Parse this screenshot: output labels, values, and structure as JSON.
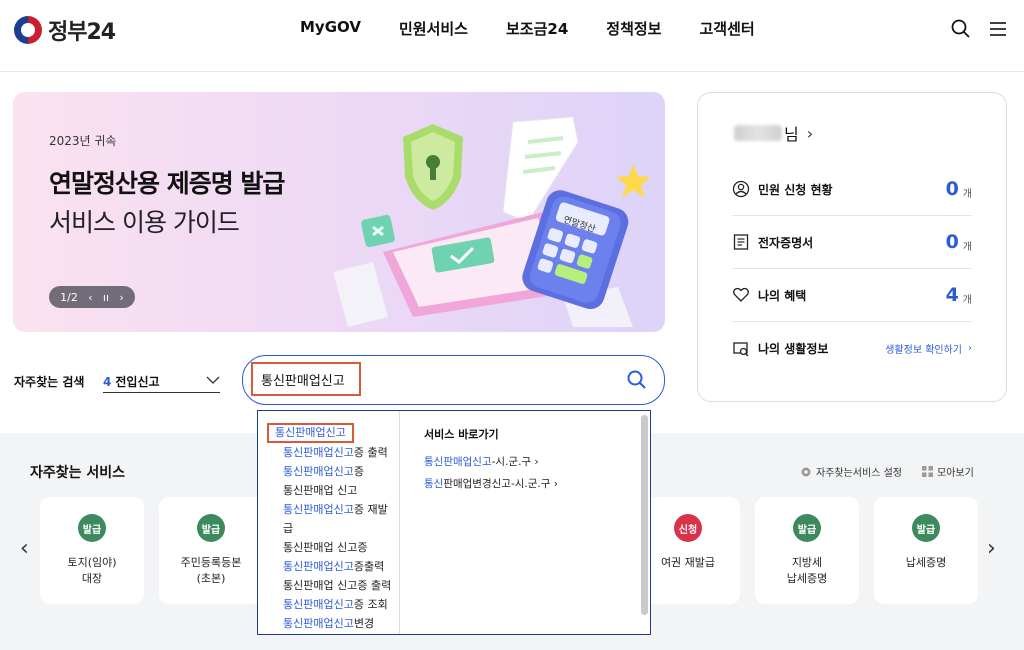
{
  "header": {
    "logo_text": "정부24",
    "nav": [
      "MyGOV",
      "민원서비스",
      "보조금24",
      "정책정보",
      "고객센터"
    ],
    "icons": [
      "search-icon",
      "menu-icon"
    ]
  },
  "banner": {
    "year": "2023년 귀속",
    "title": "연말정산용 제증명 발급",
    "subtitle": "서비스 이용 가이드",
    "pager": "1/2",
    "calculator_label": "연말정산"
  },
  "search": {
    "frequent_label": "자주찾는 검색",
    "frequent_rank": "4",
    "frequent_term": "전입신고",
    "query": "통신판매업신고"
  },
  "panel": {
    "user_suffix": "님",
    "rows": [
      {
        "label": "민원 신청 현황",
        "count": "0",
        "unit": "개"
      },
      {
        "label": "전자증명서",
        "count": "0",
        "unit": "개"
      },
      {
        "label": "나의 혜택",
        "count": "4",
        "unit": "개"
      },
      {
        "label": "나의 생활정보",
        "link": "생활정보 확인하기"
      }
    ]
  },
  "autocomplete": {
    "suggestions": [
      {
        "hl": "통신판매업신고",
        "rest": ""
      },
      {
        "hl": "통신판매업신고",
        "rest": "증 출력"
      },
      {
        "hl": "통신판매업신고",
        "rest": "증"
      },
      {
        "hl": "",
        "rest": "통신판매업 신고"
      },
      {
        "hl": "통신판매업신고",
        "rest": "증 재발"
      },
      {
        "hl": "",
        "rest": "급"
      },
      {
        "hl": "",
        "rest": "통신판매업 신고증"
      },
      {
        "hl": "통신판매업신고",
        "rest": "증출력"
      },
      {
        "hl": "",
        "rest": "통신판매업 신고증 출력"
      },
      {
        "hl": "통신판매업신고",
        "rest": "증 조회"
      },
      {
        "hl": "통신판매업신고",
        "rest": "변경"
      }
    ],
    "shortcut_heading": "서비스 바로가기",
    "shortcuts": [
      {
        "hl": "통신판매업신고",
        "rest": "-시.군.구"
      },
      {
        "hl": "통신",
        "rest": "판매업변경신고-시.군.구"
      }
    ]
  },
  "services": {
    "title": "자주찾는 서비스",
    "settings_label": "자주찾는서비스 설정",
    "view_all_label": "모아보기",
    "cards": [
      {
        "badge": "발급",
        "badge_color": "#3d8a5f",
        "label": "토지(임야)\n대장"
      },
      {
        "badge": "발급",
        "badge_color": "#3d8a5f",
        "label": "주민등록등본\n(초본)"
      },
      {
        "badge": "신청",
        "badge_color": "#d8334a",
        "label": "여권 재발급"
      },
      {
        "badge": "발급",
        "badge_color": "#3d8a5f",
        "label": "지방세\n납세증명"
      },
      {
        "badge": "발급",
        "badge_color": "#3d8a5f",
        "label": "납세증명"
      }
    ]
  }
}
